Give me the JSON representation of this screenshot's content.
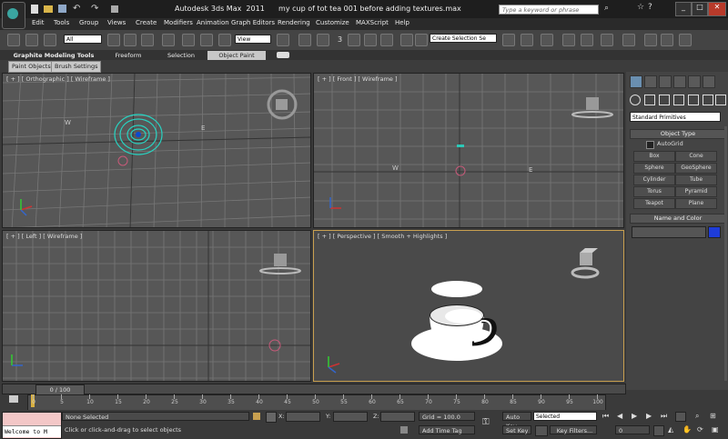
{
  "window": {
    "title": "Autodesk 3ds Max  2011      my cup of tot tea 001 before adding textures.max",
    "search_placeholder": "Type a keyword or phrase"
  },
  "menu": [
    "Edit",
    "Tools",
    "Group",
    "Views",
    "Create",
    "Modifiers",
    "Animation",
    "Graph Editors",
    "Rendering",
    "Customize",
    "MAXScript",
    "Help"
  ],
  "toolbar": {
    "selection_filter": "All",
    "reference_coord": "View",
    "named_selection": "Create Selection Se",
    "snap_label": "3"
  },
  "ribbon": {
    "tabs": [
      "Graphite Modeling Tools",
      "Freeform",
      "Selection",
      "Object Paint"
    ],
    "subtabs": [
      "Paint Objects",
      "Brush Settings"
    ]
  },
  "viewports": {
    "top_left": "[ + ] [ Orthographic ] [ Wireframe ]",
    "top_right": "[ + ] [ Front ] [ Wireframe ]",
    "bottom_left": "[ + ] [ Left ] [ Wireframe ]",
    "bottom_right": "[ + ] [ Perspective ] [ Smooth + Highlights ]",
    "axis_labels": {
      "w": "W",
      "e": "E"
    }
  },
  "command_panel": {
    "category": "Standard Primitives",
    "object_type_title": "Object Type",
    "autogrid": "AutoGrid",
    "buttons": [
      "Box",
      "Cone",
      "Sphere",
      "GeoSphere",
      "Cylinder",
      "Tube",
      "Torus",
      "Pyramid",
      "Teapot",
      "Plane"
    ],
    "name_color_title": "Name and Color"
  },
  "timeline": {
    "frame": "0 / 100",
    "ticks": [
      "0",
      "5",
      "10",
      "15",
      "20",
      "25",
      "30",
      "35",
      "40",
      "45",
      "50",
      "55",
      "60",
      "65",
      "70",
      "75",
      "80",
      "85",
      "90",
      "95",
      "100"
    ]
  },
  "status": {
    "maxscript_listener": "Welcome to M",
    "selection": "None Selected",
    "prompt": "Click or click-and-drag to select objects",
    "x_label": "X:",
    "y_label": "Y:",
    "z_label": "Z:",
    "grid": "Grid = 100.0",
    "add_time_tag": "Add Time Tag",
    "auto_key": "Auto Key",
    "auto_key_value": "Selected",
    "set_key": "Set Key",
    "key_filters": "Key Filters...",
    "current_frame": "0"
  }
}
